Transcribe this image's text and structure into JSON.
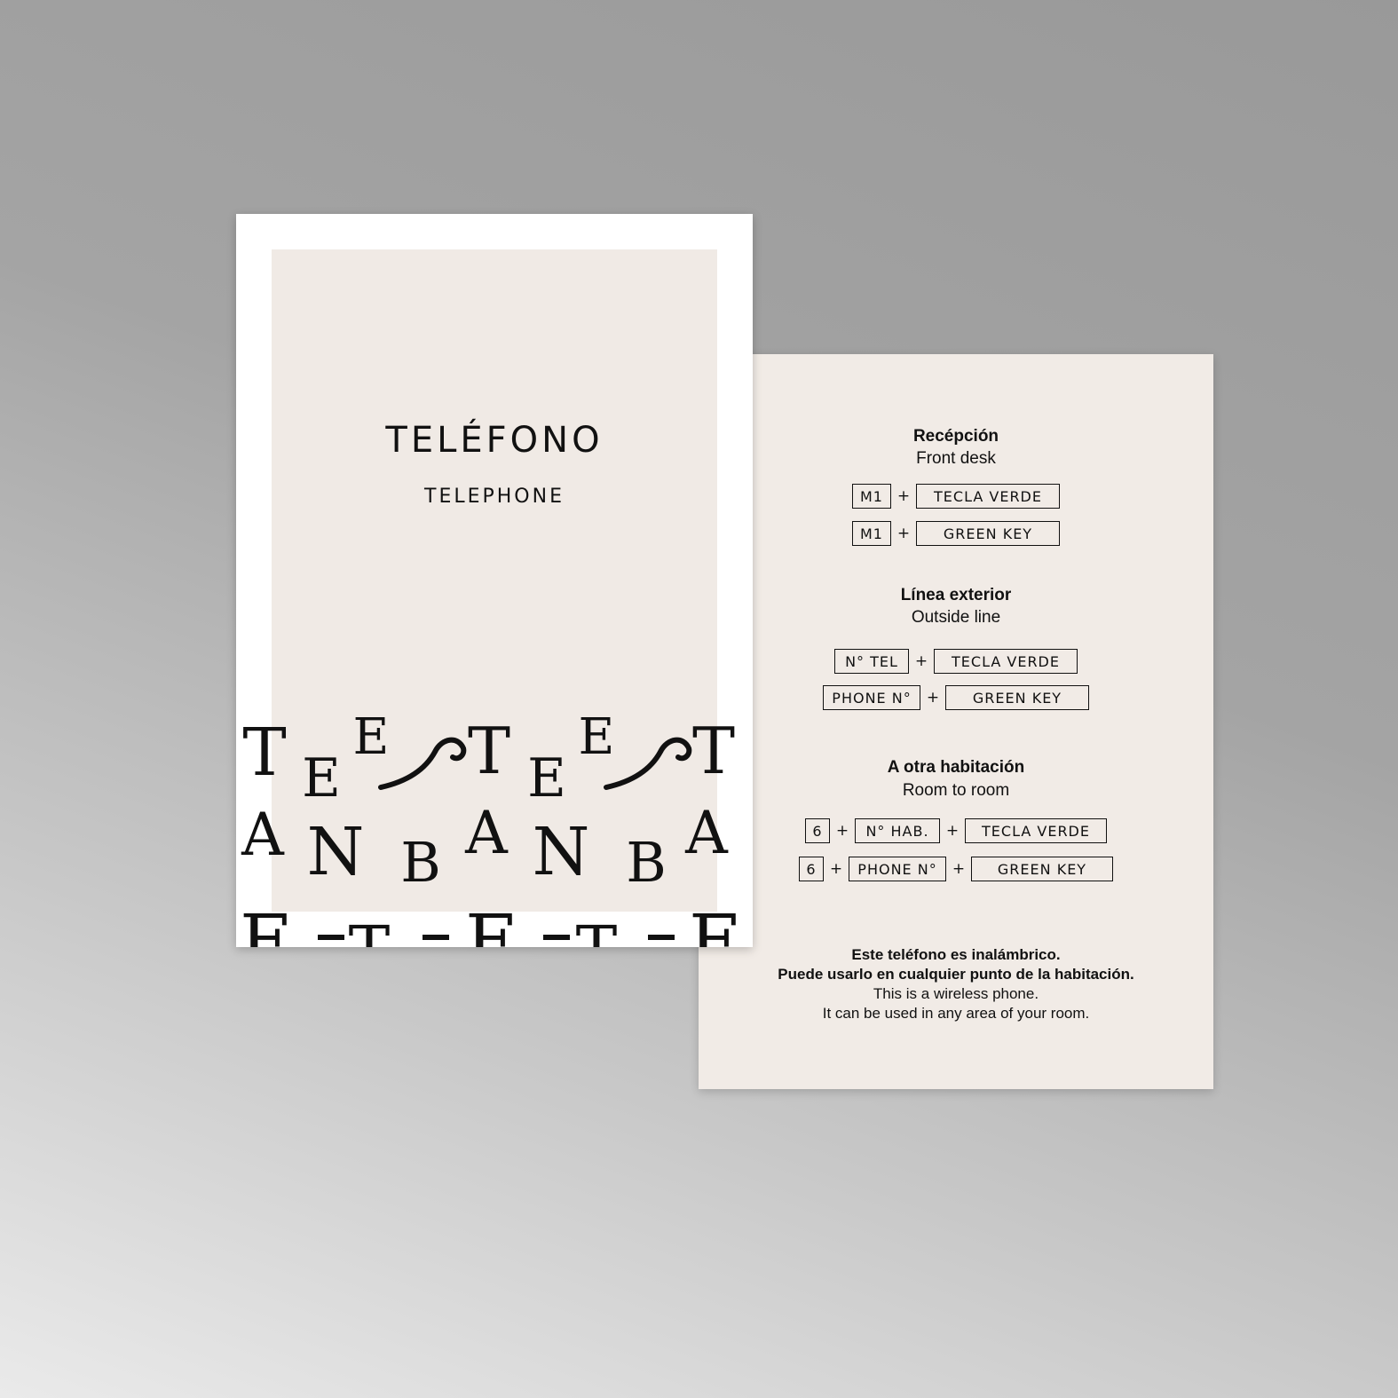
{
  "front": {
    "title": "TELÉFONO",
    "subtitle": "TELEPHONE",
    "pattern_letters": {
      "row1": [
        "T",
        "E",
        "E",
        "T",
        "E",
        "E",
        "T"
      ],
      "row2": [
        "A",
        "N",
        "B",
        "A",
        "N",
        "B",
        "A"
      ],
      "row3": [
        "E",
        "T",
        "E",
        "T",
        "E"
      ]
    }
  },
  "back": {
    "reception": {
      "title": "Recépción",
      "subtitle": "Front desk",
      "row1": {
        "k1": "M1",
        "plus": "+",
        "k2": "TECLA VERDE"
      },
      "row2": {
        "k1": "M1",
        "plus": "+",
        "k2": "GREEN KEY"
      }
    },
    "outside": {
      "title": "Línea exterior",
      "subtitle": "Outside line",
      "row1": {
        "k1": "N° TEL",
        "plus": "+",
        "k2": "TECLA VERDE"
      },
      "row2": {
        "k1": "PHONE N°",
        "plus": "+",
        "k2": "GREEN KEY"
      }
    },
    "room": {
      "title": "A otra habitación",
      "subtitle": "Room to room",
      "row1": {
        "k1": "6",
        "plus": "+",
        "k2": "N° HAB.",
        "k3": "TECLA VERDE"
      },
      "row2": {
        "k1": "6",
        "plus": "+",
        "k2": "PHONE N°",
        "k3": "GREEN KEY"
      }
    },
    "footer": {
      "line1": "Este teléfono es inalámbrico.",
      "line2": "Puede usarlo en cualquier punto de la habitación.",
      "line3": "This is a wireless phone.",
      "line4": "It can be used in any area of your room."
    }
  },
  "colors": {
    "background": "#a3a3a3",
    "card": "#f1ebe6",
    "frame": "#ffffff",
    "ink": "#111111"
  }
}
